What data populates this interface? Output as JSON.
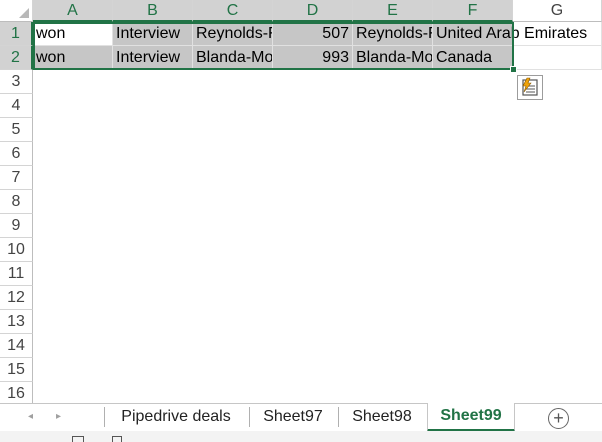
{
  "colors": {
    "accent": "#217346",
    "selection_fill": "#c6c6c6",
    "header_selected": "#d2d2d2"
  },
  "columns": [
    "A",
    "B",
    "C",
    "D",
    "E",
    "F",
    "G"
  ],
  "rows": [
    "1",
    "2",
    "3",
    "4",
    "5",
    "6",
    "7",
    "8",
    "9",
    "10",
    "11",
    "12",
    "13",
    "14",
    "15",
    "16"
  ],
  "cells": {
    "A1": "won",
    "B1": "Interview",
    "C1": "Reynolds-F",
    "D1": "507",
    "E1": "Reynolds-F",
    "F1": "United Arab Emirates",
    "A2": "won",
    "B2": "Interview",
    "C2": "Blanda-Mo",
    "D2": "993",
    "E2": "Blanda-Mo",
    "F2": "Canada"
  },
  "sheet_tabs": [
    "Pipedrive deals",
    "Sheet97",
    "Sheet98",
    "Sheet99"
  ],
  "active_sheet": "Sheet99",
  "icons": {
    "prev_sheet": "◂",
    "next_sheet": "▸",
    "add_sheet": "+",
    "quick_analysis": "quick-analysis-icon"
  }
}
